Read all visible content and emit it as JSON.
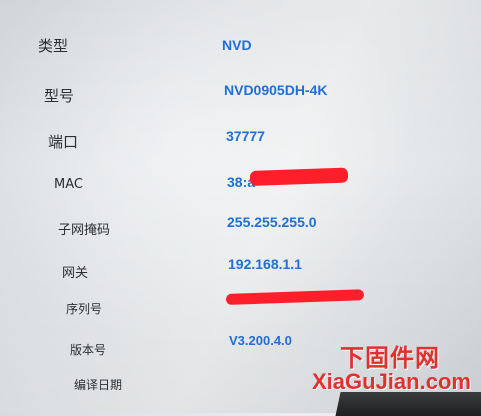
{
  "fields": [
    {
      "label": "类型",
      "value": "NVD"
    },
    {
      "label": "型号",
      "value": "NVD0905DH-4K"
    },
    {
      "label": "端口",
      "value": "37777"
    },
    {
      "label": "MAC",
      "value": "38:a"
    },
    {
      "label": "子网掩码",
      "value": "255.255.255.0"
    },
    {
      "label": "网关",
      "value": "192.168.1.1"
    },
    {
      "label": "序列号",
      "value": ""
    },
    {
      "label": "版本号",
      "value": "V3.200.4.0"
    },
    {
      "label": "编译日期",
      "value": ""
    }
  ],
  "watermark": {
    "cn": "下固件网",
    "en": "XiaGuJian.com"
  },
  "colors": {
    "value_blue": "#1e6fd8",
    "redaction_red": "#ff1f2a",
    "watermark_red": "#e23030"
  }
}
